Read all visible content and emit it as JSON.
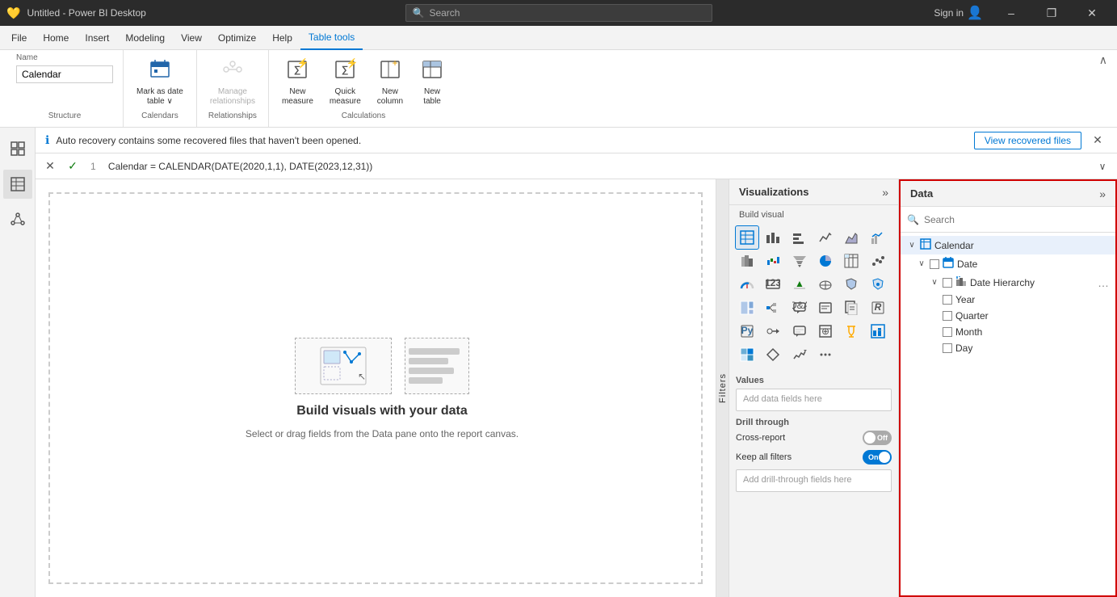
{
  "titlebar": {
    "icon": "💛",
    "title": "Untitled - Power BI Desktop",
    "search_placeholder": "Search",
    "signin_label": "Sign in",
    "minimize": "–",
    "restore": "❐",
    "close": "✕"
  },
  "menubar": {
    "items": [
      {
        "id": "file",
        "label": "File"
      },
      {
        "id": "home",
        "label": "Home"
      },
      {
        "id": "insert",
        "label": "Insert"
      },
      {
        "id": "modeling",
        "label": "Modeling"
      },
      {
        "id": "view",
        "label": "View"
      },
      {
        "id": "optimize",
        "label": "Optimize"
      },
      {
        "id": "help",
        "label": "Help"
      },
      {
        "id": "table-tools",
        "label": "Table tools",
        "active": true
      }
    ]
  },
  "ribbon": {
    "name_label": "Name",
    "name_value": "Calendar",
    "structure_label": "Structure",
    "calendars_label": "Calendars",
    "relationships_label": "Relationships",
    "calculations_label": "Calculations",
    "buttons": [
      {
        "id": "mark-date",
        "label": "Mark as date\ntable ∨",
        "icon": "📅",
        "group": "calendars"
      },
      {
        "id": "manage-rel",
        "label": "Manage\nrelationships",
        "icon": "🔗",
        "group": "relationships",
        "disabled": false
      },
      {
        "id": "new-measure",
        "label": "New\nmeasure",
        "icon": "∑",
        "group": "calculations"
      },
      {
        "id": "quick-measure",
        "label": "Quick\nmeasure",
        "icon": "⚡",
        "group": "calculations"
      },
      {
        "id": "new-column",
        "label": "New\ncolumn",
        "icon": "📊",
        "group": "calculations"
      },
      {
        "id": "new-table",
        "label": "New\ntable",
        "icon": "📋",
        "group": "calculations"
      }
    ]
  },
  "notification": {
    "icon": "ℹ",
    "text": "Auto recovery contains some recovered files that haven't been opened.",
    "button_label": "View recovered files",
    "close_icon": "✕"
  },
  "formula_bar": {
    "cancel_icon": "✕",
    "confirm_icon": "✓",
    "formula": "Calendar = CALENDAR(DATE(2020,1,1), DATE(2023,12,31))",
    "line_number": "1",
    "expand_icon": "∨"
  },
  "canvas": {
    "title": "Build visuals with your data",
    "subtitle": "Select or drag fields from the Data pane onto the report canvas.",
    "filters_label": "Filters"
  },
  "left_sidebar": {
    "buttons": [
      {
        "id": "report-view",
        "icon": "📊"
      },
      {
        "id": "table-view",
        "icon": "⊞"
      },
      {
        "id": "model-view",
        "icon": "⬡"
      }
    ]
  },
  "visualizations": {
    "panel_title": "Visualizations",
    "expand_icon": "»",
    "build_visual_label": "Build visual",
    "visual_icons": [
      "⊞",
      "📊",
      "📈",
      "📉",
      "▦",
      "📈",
      "🌡",
      "~",
      "☀",
      "⊕",
      "📋",
      "⊞",
      "📊",
      "◉",
      "◎",
      "⊗",
      "🗺",
      "⛓",
      "☵",
      "⊡",
      "≡",
      "▥",
      "R",
      "⊞",
      "🐍",
      "◈",
      "💬",
      "📄",
      "🏆",
      "📊",
      "⊞",
      "◆",
      "🔺",
      "…",
      "",
      ""
    ],
    "values_label": "Values",
    "values_placeholder": "Add data fields here",
    "drill_through_label": "Drill through",
    "cross_report_label": "Cross-report",
    "cross_report_state": "off",
    "cross_report_state_label": "Off",
    "keep_filters_label": "Keep all filters",
    "keep_filters_state": "on",
    "keep_filters_state_label": "On",
    "drill_placeholder": "Add drill-through fields here"
  },
  "data_panel": {
    "panel_title": "Data",
    "expand_icon": "»",
    "search_placeholder": "Search",
    "tree": [
      {
        "id": "calendar",
        "label": "Calendar",
        "icon": "⊞",
        "level": 0,
        "expanded": true,
        "chevron": "∨",
        "children": [
          {
            "id": "date",
            "label": "Date",
            "icon": "📅",
            "level": 1,
            "expanded": true,
            "chevron": "∨",
            "children": [
              {
                "id": "date-hierarchy",
                "label": "Date Hierarchy",
                "icon": "🔀",
                "level": 2,
                "expanded": true,
                "chevron": "∨",
                "more": "…",
                "children": [
                  {
                    "id": "year",
                    "label": "Year",
                    "level": 3,
                    "checked": false
                  },
                  {
                    "id": "quarter",
                    "label": "Quarter",
                    "level": 3,
                    "checked": false
                  },
                  {
                    "id": "month",
                    "label": "Month",
                    "level": 3,
                    "checked": false
                  },
                  {
                    "id": "day",
                    "label": "Day",
                    "level": 3,
                    "checked": false
                  }
                ]
              }
            ]
          }
        ]
      }
    ]
  }
}
